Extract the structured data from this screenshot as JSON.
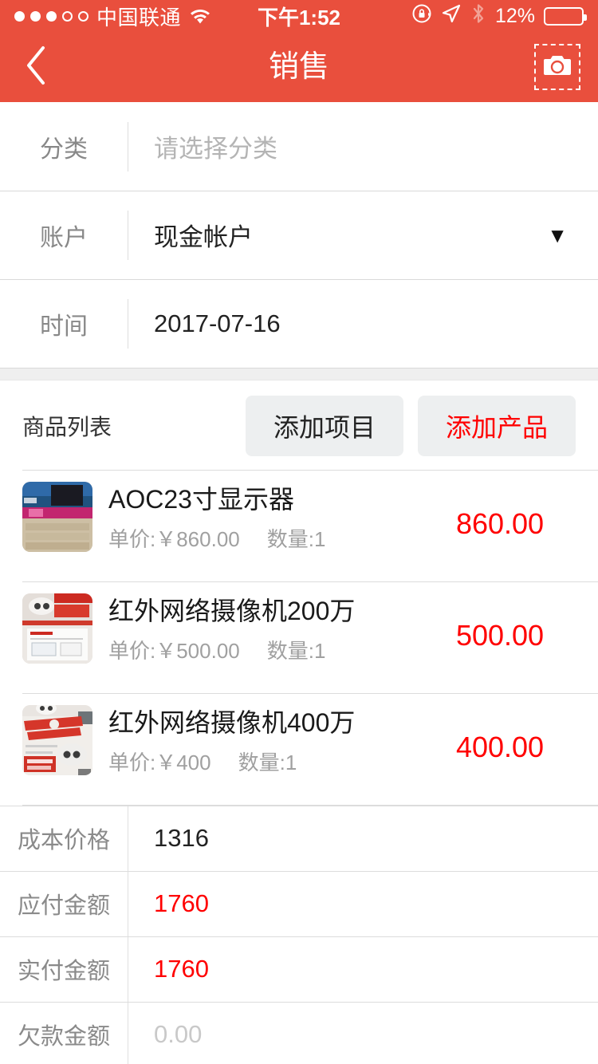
{
  "status_bar": {
    "signal_dots_filled": 3,
    "signal_dots_total": 5,
    "carrier": "中国联通",
    "wifi_icon": "wifi-icon",
    "time": "下午1:52",
    "rotation_lock_icon": "rotation-lock-icon",
    "location_icon": "location-arrow-icon",
    "bluetooth_icon": "bluetooth-icon",
    "battery_percent": "12%",
    "battery_level": 12,
    "battery_color": "#FF3B30"
  },
  "nav": {
    "back_icon": "chevron-left-icon",
    "title": "销售",
    "camera_icon": "camera-icon"
  },
  "theme": {
    "header_red": "#E94F3D",
    "accent_red": "#FF0000",
    "button_bg": "#EDEFF0",
    "divider": "#dcdcdc",
    "band_bg": "#EFEFEF"
  },
  "form": {
    "rows": [
      {
        "label": "分类",
        "value": "",
        "placeholder": "请选择分类",
        "has_caret": false
      },
      {
        "label": "账户",
        "value": "现金帐户",
        "placeholder": "",
        "has_caret": true,
        "caret": "▼"
      },
      {
        "label": "时间",
        "value": "2017-07-16",
        "placeholder": "",
        "has_caret": false
      }
    ]
  },
  "goods": {
    "title": "商品列表",
    "add_item_label": "添加项目",
    "add_product_label": "添加产品",
    "items": [
      {
        "name": "AOC23寸显示器",
        "unit_price_label": "单价:￥860.00",
        "quantity_label": "数量:1",
        "amount": "860.00",
        "thumb": "product-photo-monitor-box"
      },
      {
        "name": "红外网络摄像机200万",
        "unit_price_label": "单价:￥500.00",
        "quantity_label": "数量:1",
        "amount": "500.00",
        "thumb": "product-photo-camera-200w"
      },
      {
        "name": "红外网络摄像机400万",
        "unit_price_label": "单价:￥400",
        "quantity_label": "数量:1",
        "amount": "400.00",
        "thumb": "product-photo-camera-400w"
      }
    ]
  },
  "summary": {
    "rows": [
      {
        "label": "成本价格",
        "value": "1316",
        "style": "normal"
      },
      {
        "label": "应付金额",
        "value": "1760",
        "style": "red"
      },
      {
        "label": "实付金额",
        "value": "1760",
        "style": "red"
      },
      {
        "label": "欠款金额",
        "value": "0.00",
        "style": "muted"
      }
    ]
  }
}
